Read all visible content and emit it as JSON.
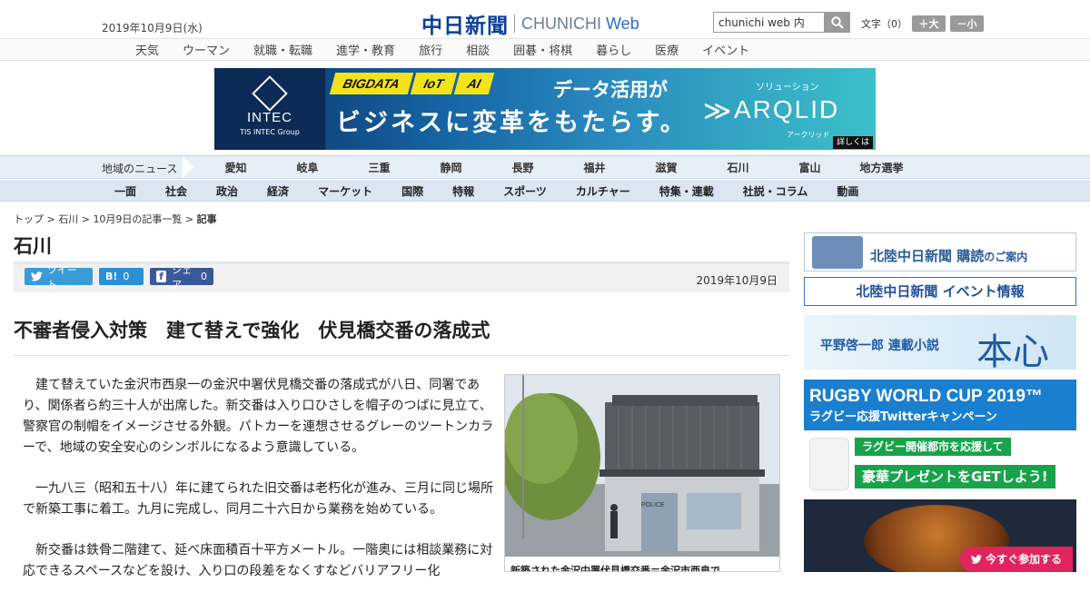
{
  "header": {
    "date": "2019年10月9日(水)",
    "logo_jp": "中日新聞",
    "logo_en": "CHUNICHI",
    "logo_web": "Web",
    "search_value": "chunichi web 内",
    "font_label": "文字（0）",
    "font_larger": "＋大",
    "font_smaller": "－小"
  },
  "subnav": [
    "天気",
    "ウーマン",
    "就職・転職",
    "進学・教育",
    "旅行",
    "相談",
    "囲碁・将棋",
    "暮らし",
    "医療",
    "イベント"
  ],
  "banner": {
    "tags": [
      "BIGDATA",
      "IoT",
      "AI"
    ],
    "headline1": "データ活用が",
    "headline2": "ビジネスに変革をもたらす。",
    "brand": "INTEC",
    "brand_sub": "TIS INTEC Group",
    "solution": "ソリューション",
    "product": "ARQLID",
    "product_sub": "アークリッド",
    "more": "詳しくは"
  },
  "region_nav": {
    "label": "地域のニュース",
    "items": [
      "愛知",
      "岐阜",
      "三重",
      "静岡",
      "長野",
      "福井",
      "滋賀",
      "石川",
      "富山",
      "地方選挙"
    ]
  },
  "main_nav": [
    "一面",
    "社会",
    "政治",
    "経済",
    "マーケット",
    "国際",
    "特報",
    "スポーツ",
    "カルチャー",
    "特集・連載",
    "社説・コラム",
    "動画"
  ],
  "breadcrumb": {
    "top": "トップ",
    "region": "石川",
    "list": "10月9日の記事一覧",
    "current": "記事",
    "sep": " > "
  },
  "page_title": "石川",
  "share": {
    "tweet": "ツイート",
    "hatena_count": "0",
    "facebook": "シェア",
    "facebook_count": "0",
    "date": "2019年10月9日"
  },
  "article": {
    "headline": "不審者侵入対策　建て替えで強化　伏見橋交番の落成式",
    "paragraphs": [
      "建て替えていた金沢市西泉一の金沢中署伏見橋交番の落成式が八日、同署であり、関係者ら約三十人が出席した。新交番は入り口ひさしを帽子のつばに見立て、警察官の制帽をイメージさせる外観。パトカーを連想させるグレーのツートンカラーで、地域の安全安心のシンボルになるよう意識している。",
      "一九八三（昭和五十八）年に建てられた旧交番は老朽化が進み、三月に同じ場所で新築工事に着工。九月に完成し、同月二十六日から業務を始めている。",
      "新交番は鉄骨二階建て、延べ床面積百十平方メートル。一階奥には相談業務に対応できるスペースなどを設け、入り口の段差をなくすなどバリアフリー化"
    ],
    "photo_caption": "新築された金沢中署伏見橋交番＝金沢市西泉で",
    "police_sign": "POLICE"
  },
  "sidebar": {
    "ad1_title": "北陸中日新聞 購読",
    "ad1_sub": "のご案内",
    "ad2": "北陸中日新聞 イベント情報",
    "ad3_a": "平野啓一郎 連載小説",
    "ad3_b": "本心",
    "ad4_title": "RUGBY WORLD CUP 2019™",
    "ad4_sub": "ラグビー応援Twitterキャンペーン",
    "ad4_g1": "ラグビー開催都市を応援して",
    "ad4_g2": "豪華プレゼントをGETしよう!",
    "ad4_cta": "今すぐ参加する"
  }
}
